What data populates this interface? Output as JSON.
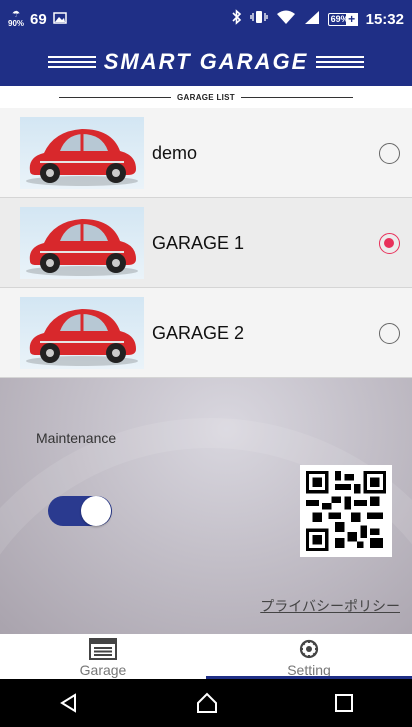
{
  "status_bar": {
    "badge": "90%",
    "notification_count": "69",
    "battery": "69%",
    "time": "15:32"
  },
  "header": {
    "title": "SMART GARAGE"
  },
  "garage_list": {
    "heading": "GARAGE LIST",
    "items": [
      {
        "name": "demo",
        "selected": false
      },
      {
        "name": "GARAGE 1",
        "selected": true
      },
      {
        "name": "GARAGE 2",
        "selected": false
      }
    ]
  },
  "settings": {
    "maintenance_label": "Maintenance",
    "maintenance_on": true,
    "privacy_link": "プライバシーポリシー"
  },
  "tabs": [
    {
      "label": "Garage",
      "icon": "garage-icon",
      "active": false
    },
    {
      "label": "Setting",
      "icon": "setting-icon",
      "active": true
    }
  ],
  "colors": {
    "primary": "#1f2f86",
    "radio_selected": "#e8305a",
    "car_red": "#d8282c"
  }
}
